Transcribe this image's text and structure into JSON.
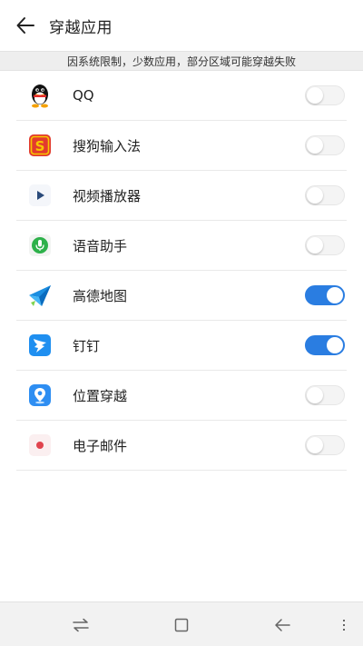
{
  "header": {
    "title": "穿越应用",
    "back_icon": "arrow-left-icon"
  },
  "notice": "因系统限制，少数应用，部分区域可能穿越失败",
  "items": [
    {
      "label": "QQ",
      "icon": "qq-penguin-icon",
      "enabled": false
    },
    {
      "label": "搜狗输入法",
      "icon": "sogou-icon",
      "enabled": false
    },
    {
      "label": "视频播放器",
      "icon": "play-icon",
      "enabled": false
    },
    {
      "label": "语音助手",
      "icon": "microphone-icon",
      "enabled": false
    },
    {
      "label": "高德地图",
      "icon": "amap-icon",
      "enabled": true
    },
    {
      "label": "钉钉",
      "icon": "dingtalk-icon",
      "enabled": true
    },
    {
      "label": "位置穿越",
      "icon": "location-pin-icon",
      "enabled": false
    },
    {
      "label": "电子邮件",
      "icon": "email-icon",
      "enabled": false
    }
  ],
  "colors": {
    "toggle_on": "#2a7de1",
    "notice_bg": "#eeeeee"
  },
  "navbar": {
    "buttons": [
      "switch-apps-icon",
      "home-square-icon",
      "back-arrow-icon",
      "more-dots-icon"
    ]
  }
}
